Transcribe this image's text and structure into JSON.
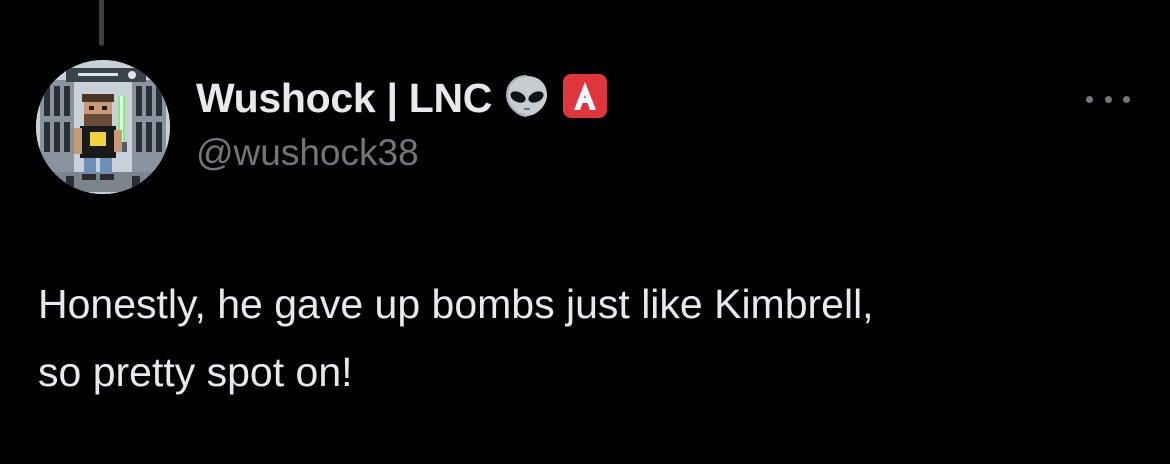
{
  "tweet": {
    "author": {
      "display_name": "Wushock | LNC",
      "handle": "@wushock38",
      "badges": [
        "alien-emoji",
        "letter-a-emoji"
      ]
    },
    "text_line_1": "Honestly, he gave up bombs just like Kimbrell,",
    "text_line_2": "so pretty spot on!"
  },
  "icons": {
    "more": "more-horizontal-icon"
  },
  "colors": {
    "background": "#000000",
    "primary_text": "#e7e9ea",
    "secondary_text": "#71767b",
    "thread_line": "#3e4144",
    "badge_red": "#e0353a"
  }
}
